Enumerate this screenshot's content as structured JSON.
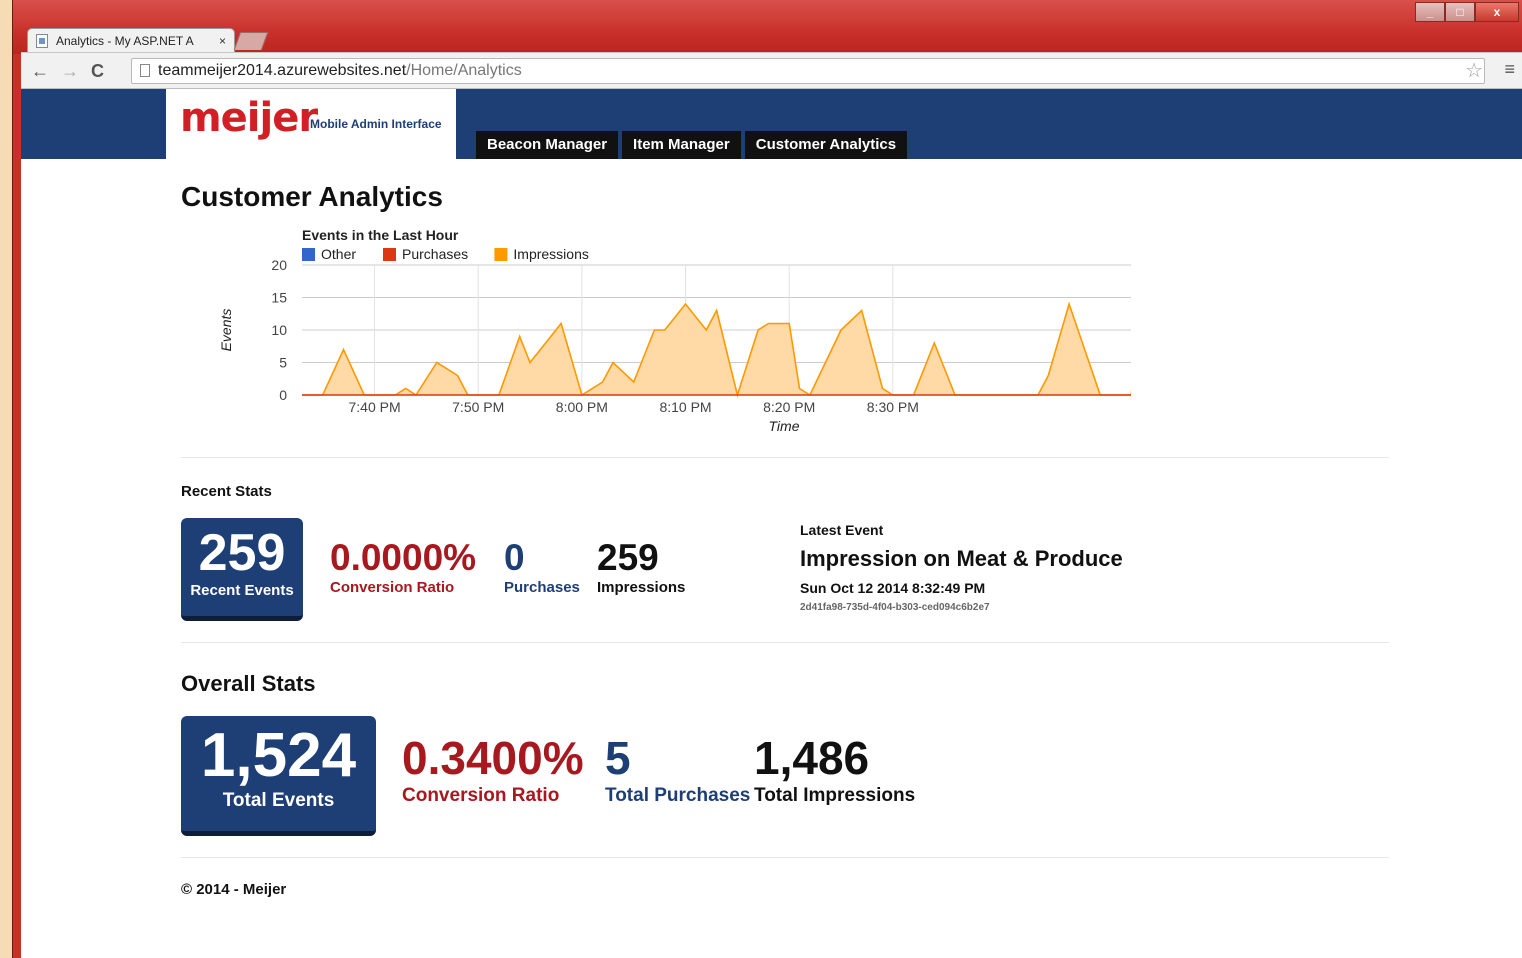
{
  "browser": {
    "tab_title": "Analytics - My ASP.NET A",
    "tab_close": "×",
    "url_host": "teammeijer2014.azurewebsites.net",
    "url_path": "/Home/Analytics",
    "window_controls": [
      "minimize",
      "maximize",
      "close"
    ]
  },
  "site": {
    "logo": "meijer",
    "logo_subtitle": "Mobile Admin Interface",
    "nav": [
      {
        "label": "Beacon Manager"
      },
      {
        "label": "Item Manager"
      },
      {
        "label": "Customer Analytics"
      }
    ]
  },
  "page": {
    "title": "Customer Analytics"
  },
  "chart_data": {
    "type": "area",
    "title": "Events in the Last Hour",
    "xlabel": "Time",
    "ylabel": "Events",
    "ylim": [
      0,
      20
    ],
    "yticks": [
      0,
      5,
      10,
      15,
      20
    ],
    "xticks": [
      "7:40 PM",
      "7:50 PM",
      "8:00 PM",
      "8:10 PM",
      "8:20 PM",
      "8:30 PM"
    ],
    "legend": [
      "Other",
      "Purchases",
      "Impressions"
    ],
    "legend_position": "top-left",
    "grid": true,
    "colors": {
      "Other": "#3366cc",
      "Purchases": "#dc3912",
      "Impressions": "#ff9900"
    },
    "x_unit": "minutes after 7:33 PM",
    "series": [
      {
        "name": "Impressions",
        "points": [
          [
            0,
            0
          ],
          [
            2,
            0
          ],
          [
            4,
            7
          ],
          [
            6,
            0
          ],
          [
            8,
            0
          ],
          [
            9,
            0
          ],
          [
            10,
            1
          ],
          [
            11,
            0
          ],
          [
            13,
            5
          ],
          [
            15,
            3
          ],
          [
            16,
            0
          ],
          [
            19,
            0
          ],
          [
            21,
            9
          ],
          [
            22,
            5
          ],
          [
            24,
            9
          ],
          [
            25,
            11
          ],
          [
            27,
            0
          ],
          [
            29,
            2
          ],
          [
            30,
            5
          ],
          [
            32,
            2
          ],
          [
            34,
            10
          ],
          [
            35,
            10
          ],
          [
            37,
            14
          ],
          [
            39,
            10
          ],
          [
            40,
            13
          ],
          [
            42,
            0
          ],
          [
            44,
            10
          ],
          [
            45,
            11
          ],
          [
            47,
            11
          ],
          [
            48,
            1
          ],
          [
            49,
            0
          ],
          [
            52,
            10
          ],
          [
            54,
            13
          ],
          [
            56,
            1
          ],
          [
            57,
            0
          ],
          [
            59,
            0
          ],
          [
            61,
            8
          ],
          [
            63,
            0
          ],
          [
            69,
            0
          ],
          [
            71,
            0
          ],
          [
            72,
            3
          ],
          [
            74,
            14
          ],
          [
            77,
            0
          ],
          [
            78,
            0
          ],
          [
            79,
            0
          ],
          [
            80,
            0
          ],
          [
            81,
            15
          ],
          [
            83,
            0
          ],
          [
            84,
            0
          ],
          [
            85,
            13
          ],
          [
            87,
            2
          ],
          [
            89,
            8
          ],
          [
            91,
            12
          ],
          [
            93,
            3
          ]
        ]
      },
      {
        "name": "Purchases",
        "points": [
          [
            0,
            0
          ],
          [
            93,
            0
          ]
        ]
      },
      {
        "name": "Other",
        "points": [
          [
            0,
            0
          ],
          [
            93,
            0
          ]
        ]
      }
    ]
  },
  "recent": {
    "heading": "Recent Stats",
    "events_value": "259",
    "events_label": "Recent Events",
    "conversion_value": "0.0000%",
    "conversion_label": "Conversion Ratio",
    "purchases_value": "0",
    "purchases_label": "Purchases",
    "impressions_value": "259",
    "impressions_label": "Impressions"
  },
  "latest_event": {
    "label": "Latest Event",
    "title": "Impression on Meat & Produce",
    "datetime": "Sun Oct 12 2014 8:32:49 PM",
    "guid": "2d41fa98-735d-4f04-b303-ced094c6b2e7"
  },
  "overall": {
    "heading": "Overall Stats",
    "events_value": "1,524",
    "events_label": "Total Events",
    "conversion_value": "0.3400%",
    "conversion_label": "Conversion Ratio",
    "purchases_value": "5",
    "purchases_label": "Total Purchases",
    "impressions_value": "1,486",
    "impressions_label": "Total Impressions"
  },
  "footer": "© 2014 - Meijer"
}
